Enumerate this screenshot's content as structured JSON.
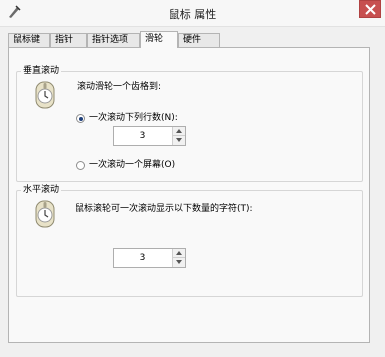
{
  "window": {
    "title": "鼠标 属性"
  },
  "tabs": [
    "鼠标键",
    "指针",
    "指针选项",
    "滑轮",
    "硬件"
  ],
  "vertical": {
    "group_title": "垂直滚动",
    "prompt": "滚动滑轮一个齿格到:",
    "option_lines": "一次滚动下列行数(N):",
    "lines_value": "3",
    "option_screen": "一次滚动一个屏幕(O)"
  },
  "horizontal": {
    "group_title": "水平滚动",
    "prompt": "鼠标滚轮可一次滚动显示以下数量的字符(T):",
    "chars_value": "3"
  },
  "icons": {
    "app": "pointer-icon",
    "close": "close-icon",
    "mouse": "mouse-icon"
  },
  "colors": {
    "close_button": "#c75050",
    "accent": "#1f3f7a"
  }
}
